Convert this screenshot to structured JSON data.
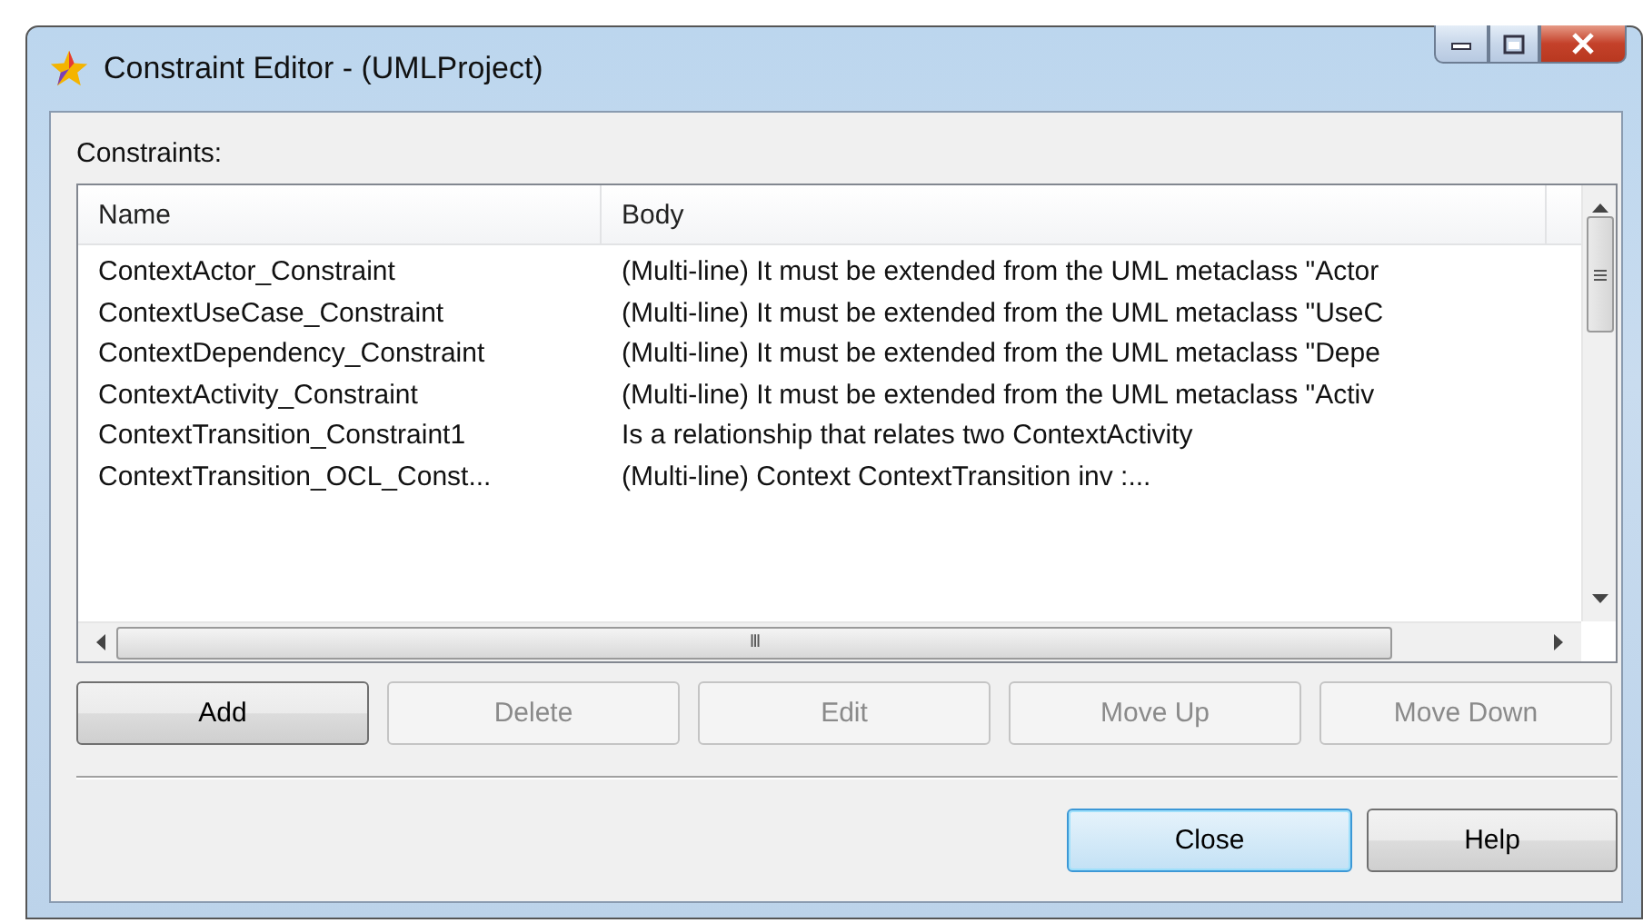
{
  "window": {
    "title": "Constraint Editor - (UMLProject)"
  },
  "list_label": "Constraints:",
  "table": {
    "columns": [
      "Name",
      "Body"
    ],
    "rows": [
      {
        "cells": [
          "ContextActor_Constraint",
          "(Multi-line) It must be extended from the UML metaclass \"Actor"
        ],
        "selected": false
      },
      {
        "cells": [
          "ContextUseCase_Constraint",
          "(Multi-line) It must be extended from the UML metaclass \"UseC"
        ],
        "selected": false
      },
      {
        "cells": [
          "ContextDependency_Constraint",
          "(Multi-line) It must be extended from the UML metaclass \"Depe"
        ],
        "selected": false
      },
      {
        "cells": [
          "ContextActivity_Constraint",
          "(Multi-line) It must be extended from the UML metaclass \"Activ"
        ],
        "selected": false
      },
      {
        "cells": [
          "ContextTransition_Constraint1",
          "Is a relationship that relates two ContextActivity"
        ],
        "selected": false
      },
      {
        "cells": [
          "ContextTransition_OCL_Const...",
          "(Multi-line) Context ContextTransition inv :..."
        ],
        "selected": false
      }
    ]
  },
  "scroll_mark": "III",
  "action_buttons": [
    {
      "label": "Add",
      "disabled": false
    },
    {
      "label": "Delete",
      "disabled": true
    },
    {
      "label": "Edit",
      "disabled": true
    },
    {
      "label": "Move Up",
      "disabled": true
    },
    {
      "label": "Move Down",
      "disabled": true
    }
  ],
  "dialog_buttons": [
    {
      "label": "Close",
      "default": true
    },
    {
      "label": "Help",
      "default": false
    }
  ]
}
